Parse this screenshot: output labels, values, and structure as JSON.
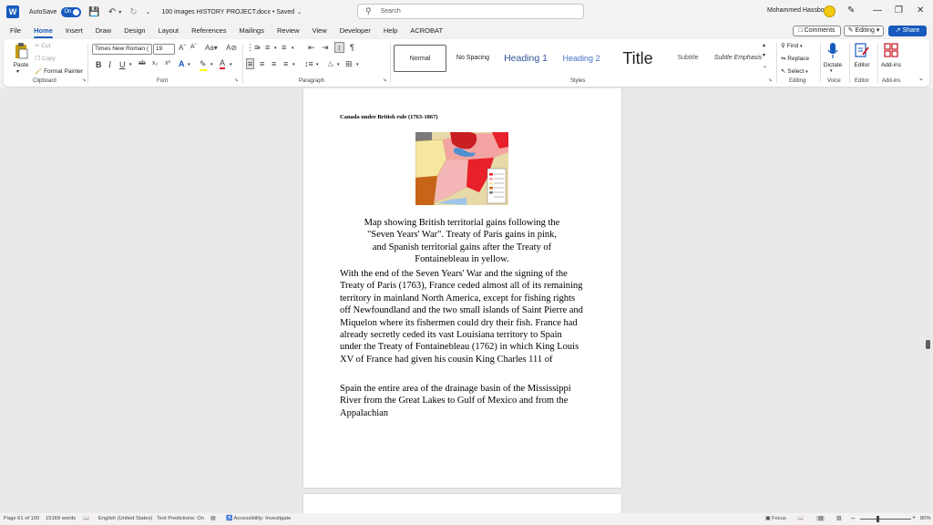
{
  "titlebar": {
    "app_logo": "W",
    "autosave_label": "AutoSave",
    "autosave_state": "On",
    "document_title": "100 images HISTORY PROJECT.docx • Saved",
    "search_placeholder": "Search",
    "user_name": "Mohammed Hassbo"
  },
  "menu": {
    "tabs": [
      "File",
      "Home",
      "Insert",
      "Draw",
      "Design",
      "Layout",
      "References",
      "Mailings",
      "Review",
      "View",
      "Developer",
      "Help",
      "ACROBAT"
    ],
    "active": "Home",
    "comments_label": "Comments",
    "editing_label": "Editing",
    "share_label": "Share"
  },
  "ribbon": {
    "clipboard": {
      "label": "Clipboard",
      "paste": "Paste",
      "cut": "Cut",
      "copy": "Copy",
      "format_painter": "Format Painter"
    },
    "font": {
      "label": "Font",
      "font_name": "Times New Roman (",
      "font_size": "19"
    },
    "paragraph": {
      "label": "Paragraph"
    },
    "styles": {
      "label": "Styles",
      "items": [
        "Normal",
        "No Spacing",
        "Heading 1",
        "Heading 2",
        "Title",
        "Subtitle",
        "Subtle Emphasis"
      ]
    },
    "editing": {
      "label": "Editing",
      "find": "Find",
      "replace": "Replace",
      "select": "Select"
    },
    "voice": {
      "label": "Voice",
      "dictate": "Dictate"
    },
    "editor": {
      "label": "Editor",
      "editor": "Editor"
    },
    "addins": {
      "label": "Add-ins",
      "addins": "Add-ins"
    }
  },
  "document": {
    "heading": "Canada under British rule (1763-1867)",
    "caption": "Map showing British territorial gains following the \"Seven Years' War\". Treaty of Paris gains in pink, and Spanish territorial gains after the Treaty of Fontainebleau in yellow.",
    "paragraph1": "With the end of the Seven Years' War and the signing of the Treaty of Paris (1763), France ceded almost all of its remaining territory in mainland North America, except for fishing rights off Newfoundland and the two small islands of Saint Pierre and Miquelon where its fishermen could dry their fish. France had already secretly ceded its vast Louisiana territory to Spain under the Treaty of Fontainebleau (1762) in which King Louis XV of France had given his cousin King Charles 111 of",
    "paragraph2": "Spain the entire area of the drainage basin of the Mississippi River from the Great Lakes to Gulf of Mexico and from the Appalachian",
    "map_colors": {
      "british": "#e8202a",
      "treaty_of_paris": "#f4a3a3",
      "spanish": "#f5e6a0",
      "spanish_old": "#c86418"
    }
  },
  "statusbar": {
    "page": "Page 61 of 100",
    "words": "15169 words",
    "language": "English (United States)",
    "predictions": "Text Predictions: On",
    "accessibility": "Accessibility: Investigate",
    "focus": "Focus",
    "zoom": "80%"
  }
}
